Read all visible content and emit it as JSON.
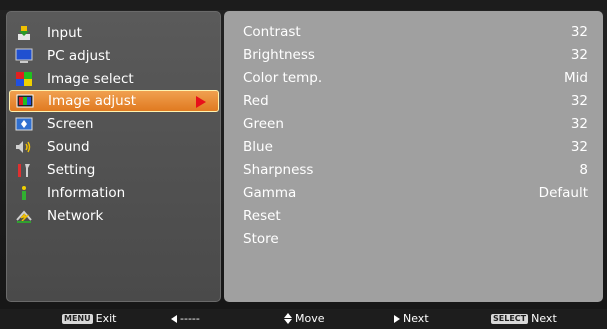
{
  "menu": {
    "items": [
      {
        "label": "Input",
        "icon": "input-icon"
      },
      {
        "label": "PC adjust",
        "icon": "pc-adjust-icon"
      },
      {
        "label": "Image select",
        "icon": "image-select-icon"
      },
      {
        "label": "Image adjust",
        "icon": "image-adjust-icon"
      },
      {
        "label": "Screen",
        "icon": "screen-icon"
      },
      {
        "label": "Sound",
        "icon": "sound-icon"
      },
      {
        "label": "Setting",
        "icon": "setting-icon"
      },
      {
        "label": "Information",
        "icon": "information-icon"
      },
      {
        "label": "Network",
        "icon": "network-icon"
      }
    ],
    "selected": "Image adjust",
    "accent_color": "#e8801f"
  },
  "params": [
    {
      "label": "Contrast",
      "value": "32"
    },
    {
      "label": "Brightness",
      "value": "32"
    },
    {
      "label": "Color temp.",
      "value": "Mid"
    },
    {
      "label": "Red",
      "value": "32"
    },
    {
      "label": "Green",
      "value": "32"
    },
    {
      "label": "Blue",
      "value": "32"
    },
    {
      "label": "Sharpness",
      "value": "8"
    },
    {
      "label": "Gamma",
      "value": "Default"
    },
    {
      "label": "Reset",
      "value": ""
    },
    {
      "label": "Store",
      "value": ""
    }
  ],
  "bottom": {
    "menu_key": "MENU",
    "exit": "Exit",
    "back": "-----",
    "move": "Move",
    "next": "Next",
    "select_key": "SELECT",
    "select_next": "Next"
  }
}
